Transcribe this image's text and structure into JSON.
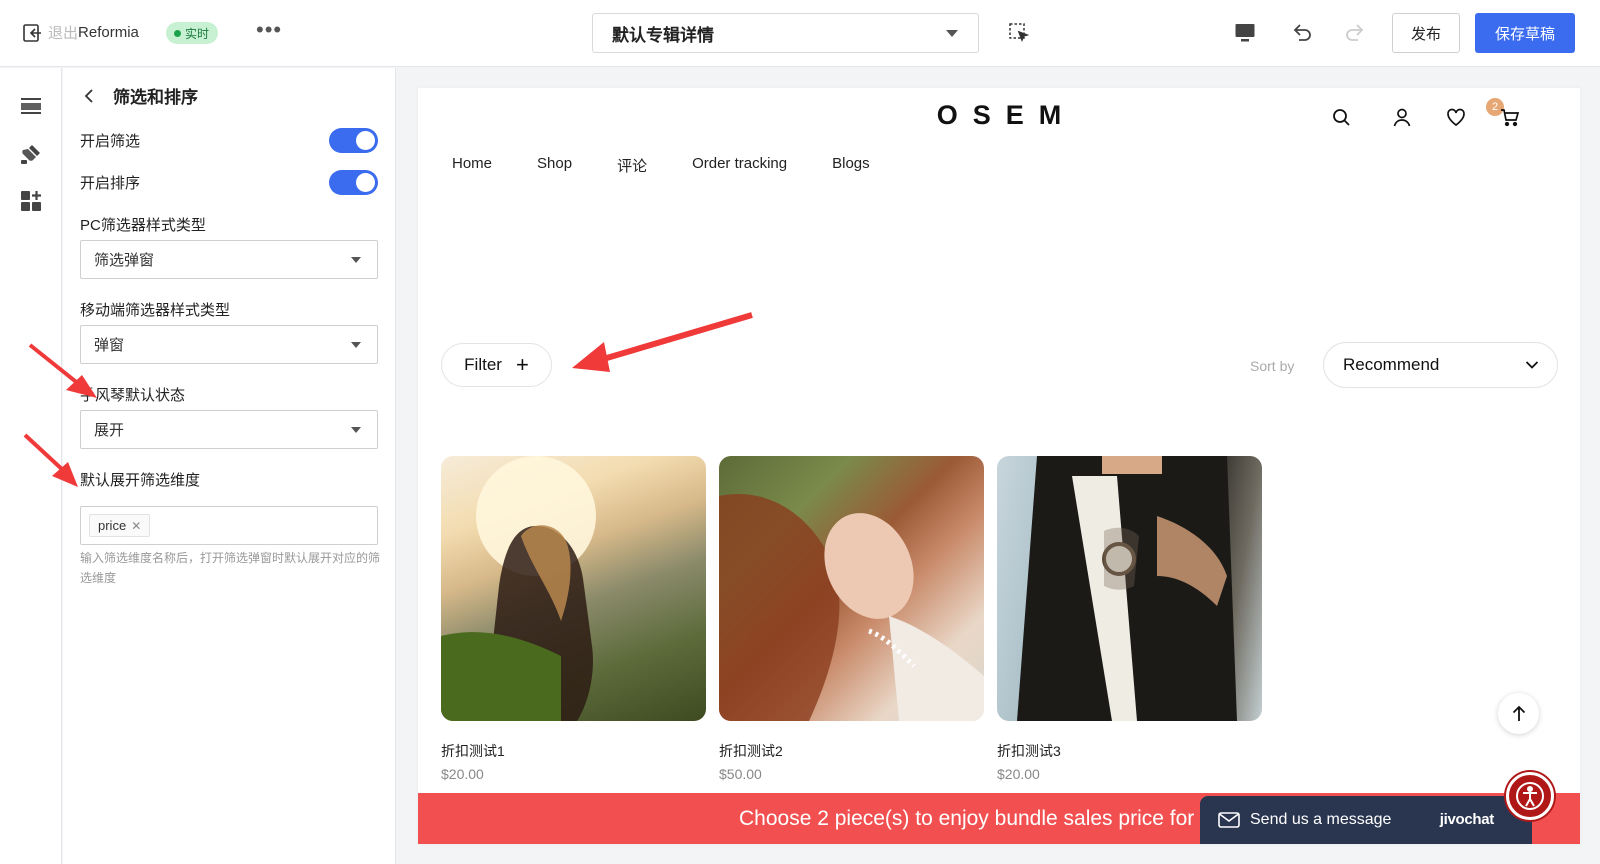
{
  "topbar": {
    "exit_label": "退出",
    "app_name": "Reformia",
    "live_label": "实时",
    "more_label": "•••",
    "page_select": "默认专辑详情",
    "publish_label": "发布",
    "save_label": "保存草稿"
  },
  "panel": {
    "title": "筛选和排序",
    "enable_filter": {
      "label": "开启筛选",
      "on": true
    },
    "enable_sort": {
      "label": "开启排序",
      "on": true
    },
    "pc_style": {
      "label": "PC筛选器样式类型",
      "value": "筛选弹窗"
    },
    "mobile_style": {
      "label": "移动端筛选器样式类型",
      "value": "弹窗"
    },
    "accordion": {
      "label": "手风琴默认状态",
      "value": "展开"
    },
    "default_expand": {
      "label": "默认展开筛选维度",
      "tags": [
        "price"
      ]
    },
    "help": "输入筛选维度名称后，打开筛选弹窗时默认展开对应的筛选维度"
  },
  "store": {
    "logo": "OSEM",
    "wishlist_count": "2",
    "nav": [
      "Home",
      "Shop",
      "评论",
      "Order tracking",
      "Blogs"
    ],
    "filter_label": "Filter",
    "sortby_label": "Sort by",
    "sort_value": "Recommend",
    "products": [
      {
        "name": "折扣测试1",
        "price": "$20.00"
      },
      {
        "name": "折扣测试2",
        "price": "$50.00"
      },
      {
        "name": "折扣测试3",
        "price": "$20.00"
      }
    ],
    "banner": "Choose 2 piece(s) to enjoy bundle sales price for",
    "chat_label": "Send us a message",
    "chat_brand": "jivochat"
  },
  "colors": {
    "primary": "#3b6cf0",
    "banner": "#f25050",
    "chat": "#2a3550",
    "live_bg": "#c8f0d3"
  }
}
